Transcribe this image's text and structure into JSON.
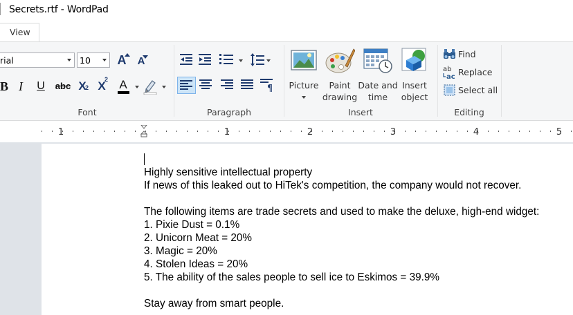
{
  "window": {
    "title": "Secrets.rtf - WordPad"
  },
  "tabs": {
    "view_label": "View"
  },
  "font_group": {
    "label": "Font",
    "font_name": "rial",
    "font_size": "10",
    "grow_glyph": "A",
    "shrink_glyph": "A",
    "bold_glyph": "B",
    "italic_glyph": "I",
    "underline_glyph": "U",
    "strike_glyph": "abc",
    "subscript_glyph": "X",
    "subscript_mark": "2",
    "superscript_glyph": "X",
    "superscript_mark": "2",
    "text_color_glyph": "A",
    "text_color": "#000000",
    "highlight_color": "#ffffff"
  },
  "paragraph_group": {
    "label": "Paragraph"
  },
  "insert_group": {
    "label": "Insert",
    "picture_label": "Picture",
    "paint_line1": "Paint",
    "paint_line2": "drawing",
    "datetime_line1": "Date and",
    "datetime_line2": "time",
    "object_line1": "Insert",
    "object_line2": "object"
  },
  "editing_group": {
    "label": "Editing",
    "find_label": "Find",
    "replace_label": "Replace",
    "select_all_label": "Select all"
  },
  "ruler": {
    "numbers": [
      "1",
      "1",
      "2",
      "3",
      "4",
      "5"
    ]
  },
  "document": {
    "lines": [
      "Highly sensitive intellectual property",
      "If news of this leaked out to HiTek's competition, the company would not recover.",
      "",
      "The following items are trade secrets and used to make the deluxe, high-end widget:",
      "1. Pixie Dust = 0.1%",
      "2. Unicorn Meat = 20%",
      "3. Magic = 20%",
      "4. Stolen Ideas = 20%",
      "5. The ability of the sales people to sell ice to Eskimos = 39.9%",
      "",
      "Stay away from smart people."
    ]
  },
  "colors": {
    "accent": "#1e3a6e",
    "ribbon_bg": "#f5f6f7",
    "selected_btn": "#cce4f7",
    "workspace_bg": "#dfe3e8"
  }
}
